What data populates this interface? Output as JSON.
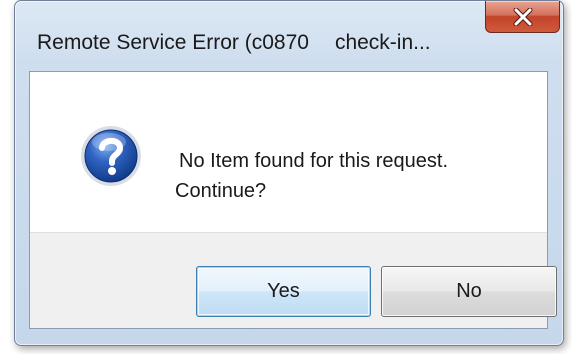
{
  "window": {
    "title_part1": "Remote Service Error (c0870",
    "title_part2": "check-in..."
  },
  "close_button": {
    "icon": "close-icon"
  },
  "message": {
    "icon": "question-icon",
    "line1": "No Item found for this request.",
    "line2": "Continue?"
  },
  "buttons": {
    "yes_label": "Yes",
    "no_label": "No"
  },
  "colors": {
    "close_red": "#c2442a",
    "question_blue": "#1e4fa3",
    "focus_border": "#3c7fb1"
  }
}
